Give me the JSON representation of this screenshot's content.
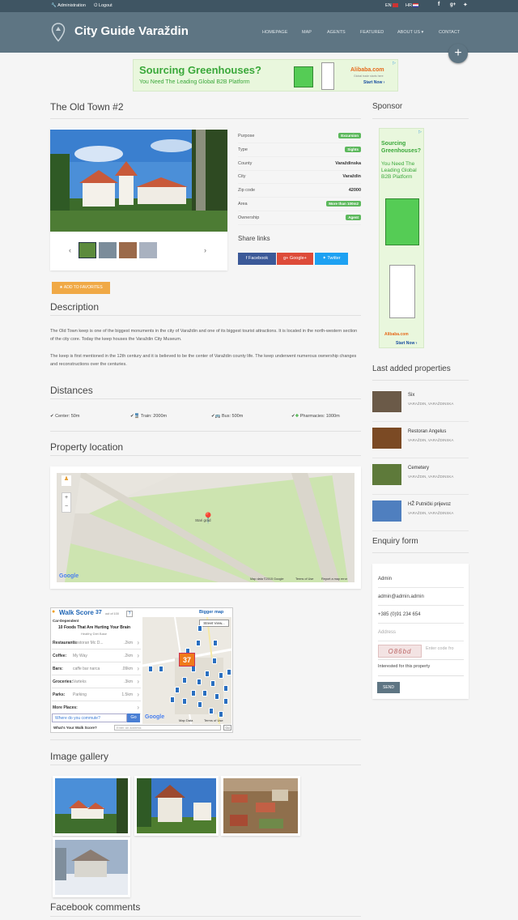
{
  "topbar": {
    "admin": "Administration",
    "logout": "Logout",
    "lang_en": "EN",
    "lang_hr": "HR"
  },
  "header": {
    "title": "City Guide Varaždin"
  },
  "nav": {
    "homepage": "HOMEPAGE",
    "map": "MAP",
    "agents": "AGENTS",
    "featured": "FEATURED",
    "about": "ABOUT US",
    "contact": "CONTACT"
  },
  "ad_banner": {
    "headline": "Sourcing Greenhouses?",
    "subline": "You Need The Leading Global B2B Platform",
    "brand": "Alibaba.com",
    "tagline": "Global trade starts here",
    "cta": "Start Now ›"
  },
  "property": {
    "title": "The Old Town #2",
    "rows": [
      {
        "k": "Purpose",
        "v": "Excursion",
        "badge": true
      },
      {
        "k": "Type",
        "v": "Sights",
        "badge": true
      },
      {
        "k": "County",
        "v": "Varaždinska",
        "badge": false
      },
      {
        "k": "City",
        "v": "Varaždin",
        "badge": false
      },
      {
        "k": "Zip code",
        "v": "42000",
        "badge": false
      },
      {
        "k": "Area",
        "v": "More than 100m2",
        "badge": true
      },
      {
        "k": "Ownership",
        "v": "Agent",
        "badge": true
      }
    ],
    "share_title": "Share links",
    "share": {
      "facebook": "Facebook",
      "google": "Google+",
      "twitter": "Twitter"
    },
    "favorites": "★ ADD TO FAVORITES"
  },
  "description": {
    "title": "Description",
    "p1": "The Old Town keep is one of the biggest monuments in the city of Varaždin and one of its biggest tourist attractions. It is located in the north-western section of the city core. Today the keep houses the Varaždin City Museum.",
    "p2": "The keep is first mentioned in the 12th century and it is believed to be the center of Varaždin county life. The keep underwent numerous ownership changes and reconstructions over the centuries."
  },
  "distances": {
    "title": "Distances",
    "items": [
      "Center: 50m",
      "Train: 2000m",
      "Bus: 500m",
      "Pharmacies: 1000m"
    ]
  },
  "location": {
    "title": "Property location",
    "marker_label": "Stari grad",
    "google": "Google",
    "footer": [
      "Map data ©2015 Google",
      "Terms of Use",
      "Report a map error"
    ]
  },
  "walkscore": {
    "brand": "Walk Score",
    "score": "37",
    "out_of": "out of 100",
    "category": "Car-Dependent",
    "article": "10 Foods That Are Hurting Your Brain",
    "article_src": "Healthy Diet Base",
    "bigger_map": "Bigger map",
    "street_view": "Street View...",
    "rows": [
      {
        "a": "Restaurants:",
        "b": "Restoran Mc D...",
        "c": ".2km"
      },
      {
        "a": "Coffee:",
        "b": "My Way",
        "c": ".2km"
      },
      {
        "a": "Bars:",
        "b": "caffe bar narca",
        "c": ".09km"
      },
      {
        "a": "Groceries:",
        "b": "Varteks",
        "c": ".3km"
      },
      {
        "a": "Parks:",
        "b": "Parking",
        "c": "1.5km"
      },
      {
        "a": "More Places:",
        "b": "",
        "c": ""
      }
    ],
    "commute_placeholder": "Where do you commute?",
    "go": "Go",
    "question": "What's Your Walk Score?",
    "address_placeholder": "Enter an address",
    "map_data": "Map Data",
    "terms": "Terms of Use",
    "google": "Google"
  },
  "gallery": {
    "title": "Image gallery"
  },
  "facebook": {
    "title": "Facebook comments"
  },
  "sidebar": {
    "sponsor_title": "Sponsor",
    "sponsor_ad": {
      "headline": "Sourcing Greenhouses?",
      "subline": "You Need The Leading Global B2B Platform",
      "brand": "Alibaba.com",
      "cta": "Start Now ›"
    },
    "last_added_title": "Last added properties",
    "last_added": [
      {
        "title": "Six",
        "sub": "VARAŽDIN, VARAŽDINSKA"
      },
      {
        "title": "Restoran Angelus",
        "sub": "VARAŽDIN, VARAŽDINSKA"
      },
      {
        "title": "Cemetery",
        "sub": "VARAŽDIN, VARAŽDINSKA"
      },
      {
        "title": "HŽ Putnički prijevoz",
        "sub": "VARAŽDIN, VARAŽDINSKA"
      }
    ],
    "enquiry_title": "Enquiry form",
    "enquiry": {
      "name": "Admin",
      "email": "admin@admin.admin",
      "phone": "+385 (0)91 234 654",
      "address_placeholder": "Address",
      "captcha": "O86bd",
      "code_placeholder": "Enter code fro",
      "message": "Interested for this property",
      "send": "SEND"
    }
  }
}
